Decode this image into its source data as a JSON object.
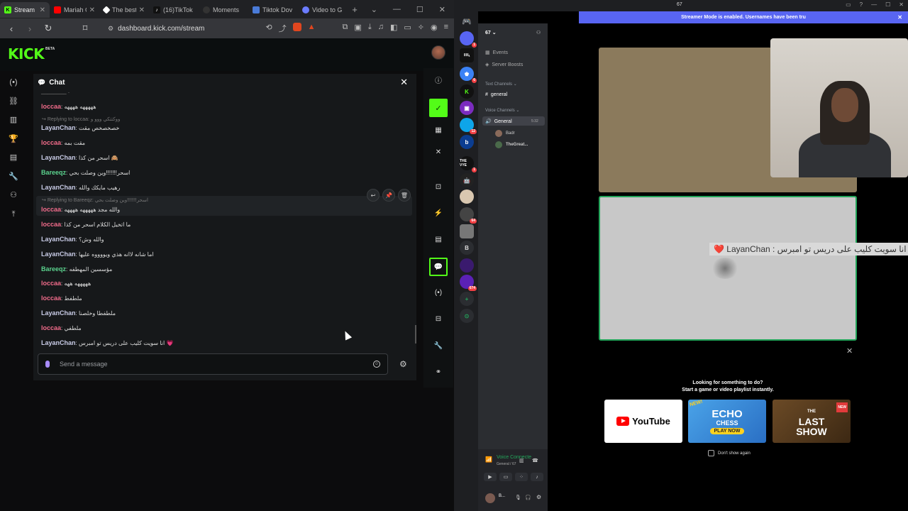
{
  "browser": {
    "tabs": [
      {
        "label": "Stream",
        "color": "#53fc18",
        "active": true
      },
      {
        "label": "Mariah Ca",
        "color": "#ff0000",
        "active": false
      },
      {
        "label": "The best C",
        "color": "#ffffff",
        "active": false
      },
      {
        "label": "(16)TikTok",
        "color": "#111111",
        "active": false
      },
      {
        "label": "Moments",
        "color": "#333333",
        "active": false
      },
      {
        "label": "Tiktok Dov",
        "color": "#4a7bd8",
        "active": false
      },
      {
        "label": "Video to G",
        "color": "#6b7cff",
        "active": false
      }
    ],
    "url": "dashboard.kick.com/stream"
  },
  "kick": {
    "logo": "KICK",
    "beta": "BETA",
    "chat_title": "Chat",
    "input_placeholder": "Send a message",
    "accent": "#53fc18"
  },
  "chat": {
    "messages": [
      {
        "reply": "",
        "user": "loccaa",
        "text": "هههههه ههههه"
      },
      {
        "reply": "Replying to loccaa: ووكتتكي ووو و",
        "user": "LayanChan",
        "text": "خصخصخص مقت"
      },
      {
        "reply": "",
        "user": "loccaa",
        "text": "مقت بمه"
      },
      {
        "reply": "",
        "user": "LayanChan",
        "text": "اسحر من كذا 🙈"
      },
      {
        "reply": "",
        "user": "Bareeqz",
        "text": "اسحر!!!!!!!وين وصلت بحي"
      },
      {
        "reply": "",
        "user": "LayanChan",
        "text": "رهيب مايكك والله"
      },
      {
        "reply": "Replying to Bareeqz: اسحر!!!!!!!وين وصلت بحي",
        "user": "loccaa",
        "text": "والله مجد هههههه ههههه"
      },
      {
        "reply": "",
        "user": "loccaa",
        "text": "ما اتخيل الكلام اسحر من كذا"
      },
      {
        "reply": "",
        "user": "LayanChan",
        "text": "والله وش؟"
      },
      {
        "reply": "",
        "user": "LayanChan",
        "text": "اما شانه لاانه هذي ويووووه عليها"
      },
      {
        "reply": "",
        "user": "Bareeqz",
        "text": "مؤسسين المهطفه"
      },
      {
        "reply": "",
        "user": "loccaa",
        "text": "هههههه ههه"
      },
      {
        "reply": "",
        "user": "loccaa",
        "text": "ملطفط"
      },
      {
        "reply": "",
        "user": "LayanChan",
        "text": "ملطفطا وخلصنا"
      },
      {
        "reply": "",
        "user": "loccaa",
        "text": "ملطفي"
      },
      {
        "reply": "",
        "user": "LayanChan",
        "text": "انا سويت كليب على دريس تو امبرس 💗"
      }
    ]
  },
  "discord": {
    "count": "67",
    "banner": "Streamer Mode is enabled. Usernames have been tru",
    "guild": "67",
    "events": "Events",
    "boosts": "Server Boosts",
    "text_channels": "Text Channels",
    "general_text": "general",
    "voice_channels": "Voice Channels",
    "general_voice": "General",
    "general_voice_time": "5:32",
    "voice_users": [
      "Badr",
      "TheGreat..."
    ],
    "voice_status": "Voice Connecte",
    "voice_sub": "General / 67",
    "me_name": "B...",
    "overlay_text": "انا سويت كليب على دريس تو امبرس : LayanChan ❤️",
    "activity_heading_1": "Looking for something to do?",
    "activity_heading_2": "Start a game or video playlist instantly.",
    "youtube": "YouTube",
    "echo_1": "ECHO",
    "echo_2": "CHESS",
    "echo_3": "PLAY NOW",
    "echo_new": "NEW!",
    "lastshow_1": "THE",
    "lastshow_2": "LAST",
    "lastshow_3": "SHOW",
    "lastshow_new": "NEW",
    "dont_show": "Don't show again",
    "servers": [
      "",
      "",
      "",
      "",
      "",
      "",
      "",
      "",
      "",
      "",
      "B",
      "",
      "",
      ""
    ],
    "server_badges": {
      "1": "1",
      "3": "8",
      "5": "12",
      "7": "1",
      "10": "",
      "11": "64",
      "13": "674"
    }
  }
}
